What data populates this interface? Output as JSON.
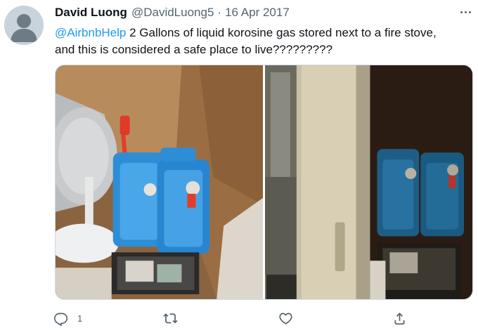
{
  "tweet": {
    "author": {
      "display_name": "David Luong",
      "handle": "@DavidLuong5"
    },
    "separator": "·",
    "date": "16 Apr 2017",
    "text": {
      "mention": "@AirbnbHelp",
      "line1": " 2 Gallons of liquid korosine gas stored next to a fire stove,",
      "line2": "and this is considered a safe place to live?????????"
    },
    "photos": [
      {
        "description_icon": "photo-icon"
      },
      {
        "description_icon": "photo-icon"
      }
    ],
    "actions": {
      "reply": {
        "icon": "reply-icon",
        "count": "1"
      },
      "retweet": {
        "icon": "retweet-icon",
        "count": ""
      },
      "like": {
        "icon": "heart-icon",
        "count": ""
      },
      "share": {
        "icon": "share-icon"
      }
    }
  },
  "colors": {
    "mention": "#1d9bf0",
    "secondary_text": "#536471",
    "primary_text": "#0f1419",
    "border": "#cfd9de"
  }
}
